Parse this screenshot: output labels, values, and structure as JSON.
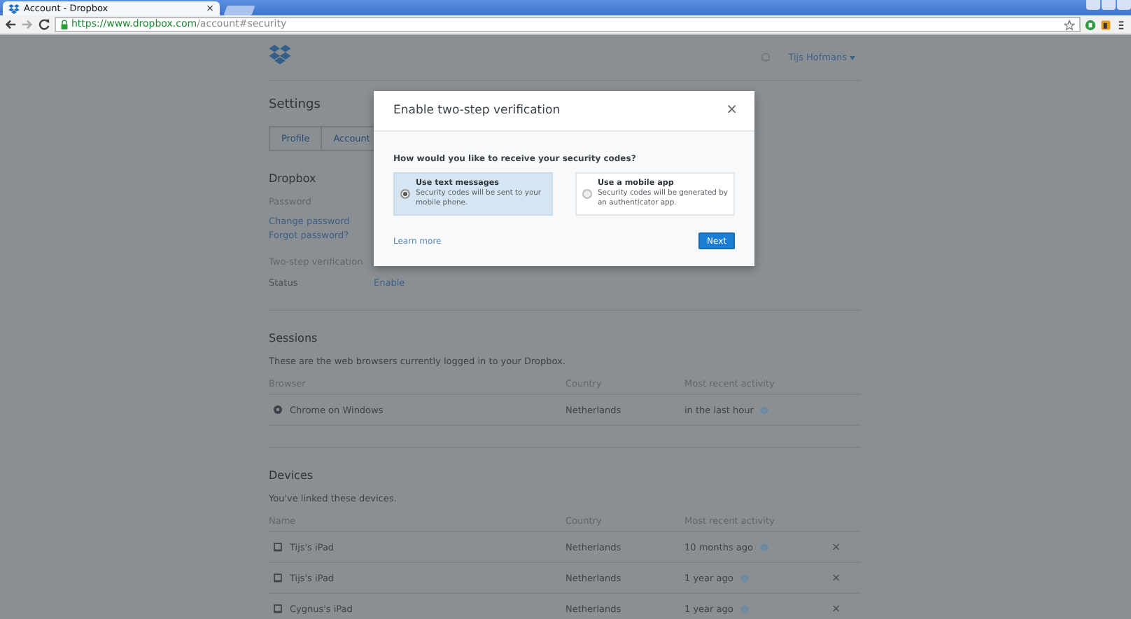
{
  "browser": {
    "tab_title": "Account - Dropbox",
    "tab_close": "×",
    "url_host": "https://www.dropbox.com",
    "url_path": "/account#security"
  },
  "header": {
    "user_name": "Tijs Hofmans"
  },
  "page": {
    "title": "Settings",
    "tabs": [
      {
        "label": "Profile",
        "selected": false
      },
      {
        "label": "Account",
        "selected": false
      }
    ],
    "dropbox": {
      "heading": "Dropbox",
      "password_label": "Password",
      "links": [
        "Change password",
        "Forgot password?"
      ],
      "two_step_label": "Two-step verification",
      "status_label": "Status",
      "status_value": "Enable"
    },
    "sessions": {
      "heading": "Sessions",
      "description": "These are the web browsers currently logged in to your Dropbox.",
      "columns": [
        "Browser",
        "Country",
        "Most recent activity"
      ],
      "rows": [
        {
          "name": "Chrome on Windows",
          "country": "Netherlands",
          "activity": "in the last hour"
        }
      ]
    },
    "devices": {
      "heading": "Devices",
      "description": "You've linked these devices.",
      "columns": [
        "Name",
        "Country",
        "Most recent activity"
      ],
      "rows": [
        {
          "name": "Tijs's iPad",
          "country": "Netherlands",
          "activity": "10 months ago",
          "remove": "×"
        },
        {
          "name": "Tijs's iPad",
          "country": "Netherlands",
          "activity": "1 year ago",
          "remove": "×"
        },
        {
          "name": "Cygnus's iPad",
          "country": "Netherlands",
          "activity": "1 year ago",
          "remove": "×"
        }
      ]
    }
  },
  "modal": {
    "title": "Enable two-step verification",
    "close": "×",
    "question": "How would you like to receive your security codes?",
    "options": [
      {
        "title": "Use text messages",
        "description": "Security codes will be sent to your mobile phone.",
        "selected": true
      },
      {
        "title": "Use a mobile app",
        "description": "Security codes will be generated by an authenticator app.",
        "selected": false
      }
    ],
    "learn_more": "Learn more",
    "next": "Next"
  }
}
